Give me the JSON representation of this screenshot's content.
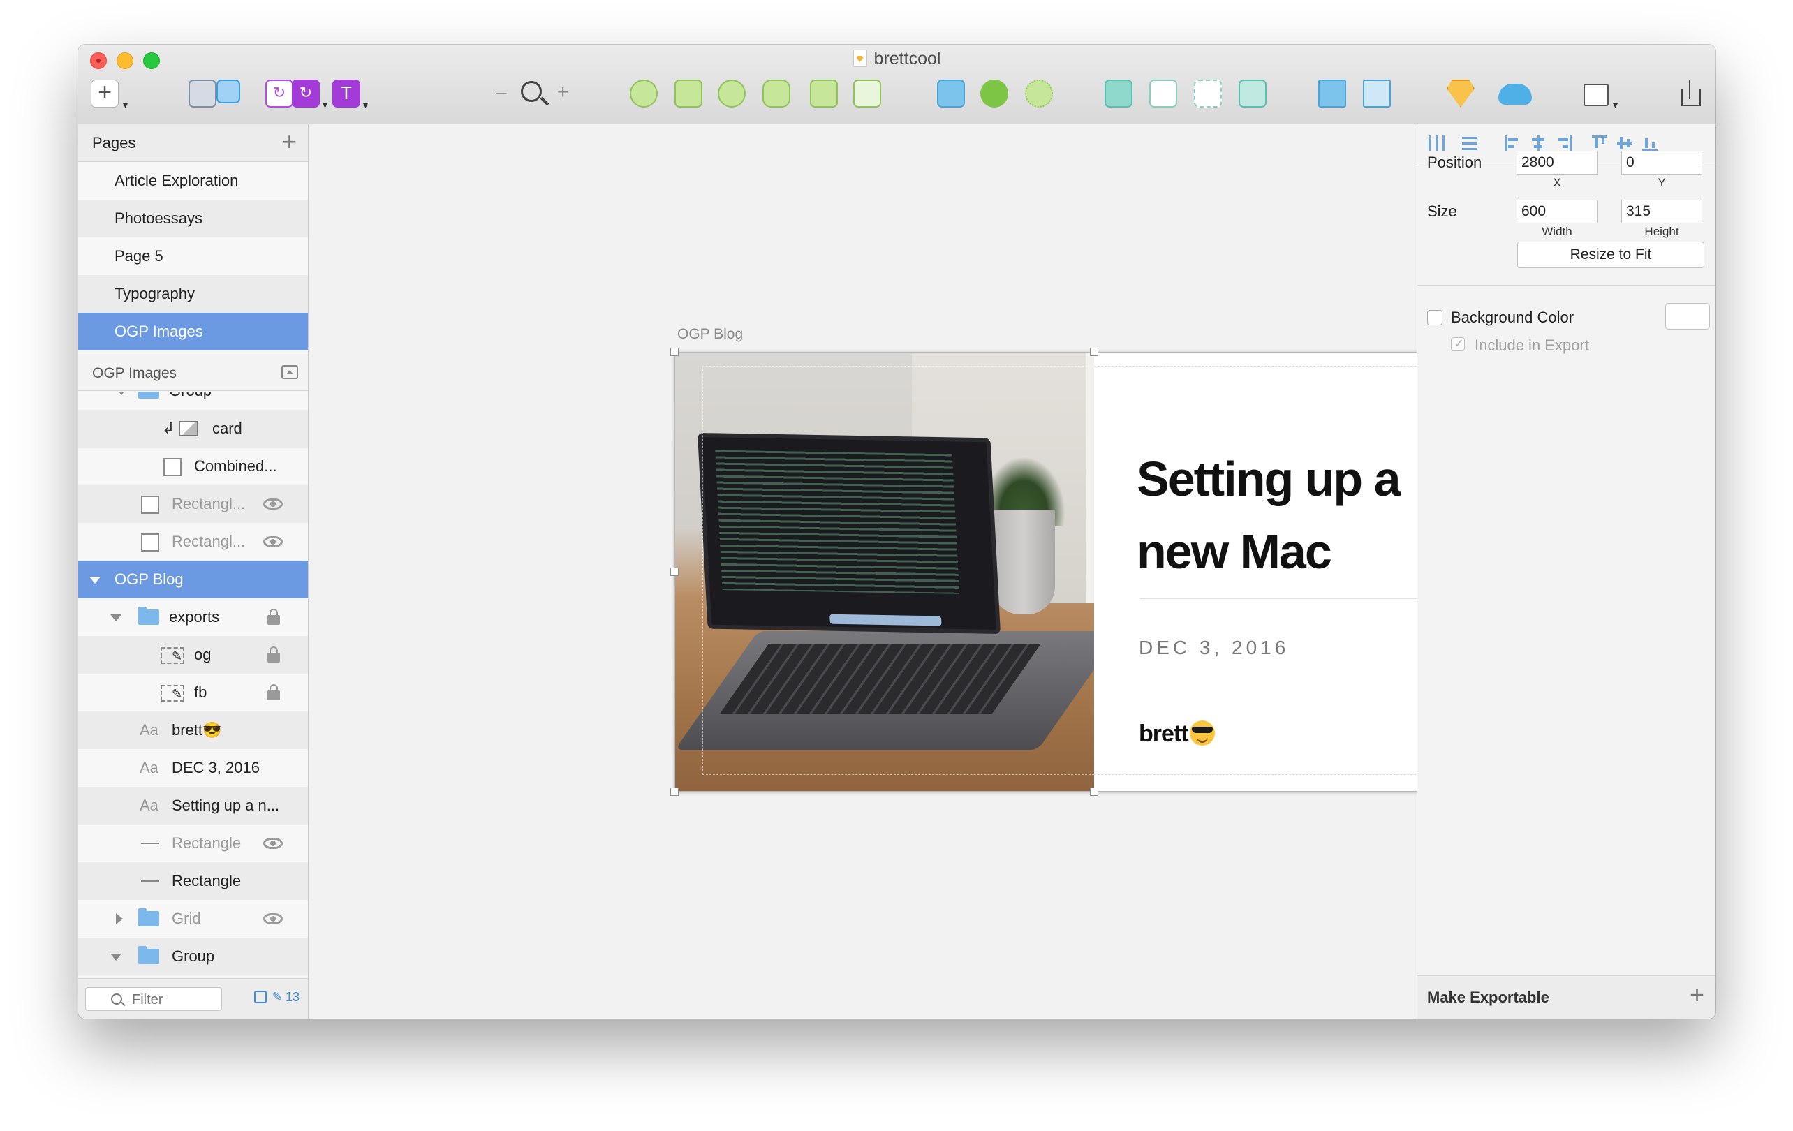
{
  "window": {
    "title": "brettcool"
  },
  "toolbar": {
    "insert_icon": "plus-icon",
    "zoom_minus": "–",
    "zoom_plus": "+",
    "symbol_label": "↻",
    "text_tool_label": "T",
    "dropdown_glyph": "▾"
  },
  "pages": {
    "header": "Pages",
    "add": "+",
    "items": [
      {
        "label": "Article Exploration"
      },
      {
        "label": "Photoessays"
      },
      {
        "label": "Page 5"
      },
      {
        "label": "Typography"
      },
      {
        "label": "OGP Images",
        "selected": true
      }
    ]
  },
  "layers": {
    "header": "OGP Images",
    "items": [
      {
        "name": "Group",
        "type": "folder"
      },
      {
        "name": "card",
        "type": "image-mask"
      },
      {
        "name": "Combined...",
        "type": "shape"
      },
      {
        "name": "Rectangl...",
        "type": "shape",
        "hidden": true
      },
      {
        "name": "Rectangl...",
        "type": "shape",
        "hidden": true
      },
      {
        "name": "OGP Blog",
        "type": "artboard",
        "selected": true
      },
      {
        "name": "exports",
        "type": "folder",
        "locked": true
      },
      {
        "name": "og",
        "type": "slice",
        "locked": true
      },
      {
        "name": "fb",
        "type": "slice",
        "locked": true
      },
      {
        "name": "brett😎",
        "type": "text"
      },
      {
        "name": "DEC 3, 2016",
        "type": "text"
      },
      {
        "name": "Setting up a n...",
        "type": "text"
      },
      {
        "name": "Rectangle",
        "type": "line",
        "hidden": true
      },
      {
        "name": "Rectangle",
        "type": "line"
      },
      {
        "name": "Grid",
        "type": "folder",
        "hidden": true
      },
      {
        "name": "Group",
        "type": "folder"
      }
    ],
    "text_icon": "Aa",
    "filter_placeholder": "Filter",
    "selection_count": "13"
  },
  "artboard": {
    "label": "OGP Blog",
    "headline": "Setting up a new Mac",
    "date": "DEC 3, 2016",
    "brand": "brett"
  },
  "inspector": {
    "position_label": "Position",
    "x_value": "2800",
    "y_value": "0",
    "x_label": "X",
    "y_label": "Y",
    "size_label": "Size",
    "width_value": "600",
    "height_value": "315",
    "width_label": "Width",
    "height_label": "Height",
    "resize_button": "Resize to Fit",
    "background_color_label": "Background Color",
    "include_in_export_label": "Include in Export",
    "make_exportable_label": "Make Exportable",
    "add": "+"
  },
  "colors": {
    "selection": "#6b9ae3",
    "accent_blue": "#3b8be0",
    "traffic_close": "#fc5f57",
    "traffic_min": "#fdbc2e",
    "traffic_max": "#28c840"
  }
}
